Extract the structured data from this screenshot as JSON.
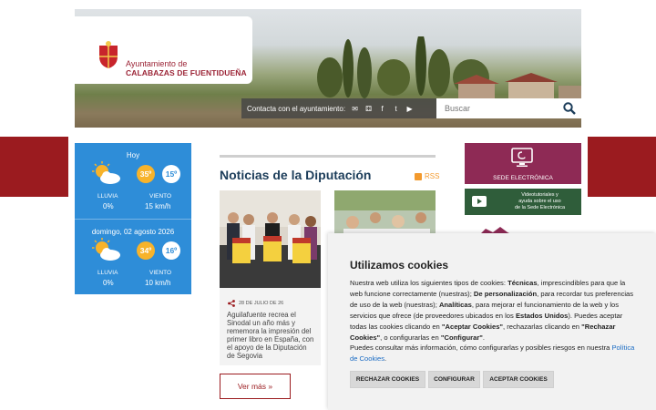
{
  "header": {
    "logo_line1": "Ayuntamiento de",
    "logo_line2": "CALABAZAS DE FUENTIDUEÑA",
    "contact_label": "Contacta con el ayuntamiento:",
    "contact_icons": [
      "mail-icon",
      "sitemap-icon",
      "facebook-icon",
      "twitter-icon",
      "youtube-icon"
    ],
    "search_placeholder": "Buscar"
  },
  "weather": {
    "days": [
      {
        "date": "Hoy",
        "tmax": "35º",
        "tmin": "15º",
        "rain_label": "LLUVIA",
        "rain": "0%",
        "wind_label": "VIENTO",
        "wind": "15 km/h"
      },
      {
        "date": "domingo, 02 agosto 2026",
        "tmax": "34º",
        "tmin": "16º",
        "rain_label": "LLUVIA",
        "rain": "0%",
        "wind_label": "VIENTO",
        "wind": "10 km/h"
      }
    ]
  },
  "news": {
    "title": "Noticias de la Diputación",
    "rss": "RSS",
    "cards": [
      {
        "date": "28 DE JULIO DE 26",
        "text": "Aguilafuente recrea el Sinodal un año más y rememora la impresión del primer libro en España, con el apoyo de la Diputación de Segovia"
      }
    ],
    "more": "Ver más  »"
  },
  "sidebar": {
    "sede": "SEDE ELECTRÓNICA",
    "video_lines": [
      "Videotutoriales y",
      "ayuda sobre el uso",
      "de la Sede Electrónica"
    ]
  },
  "cookies": {
    "title": "Utilizamos cookies",
    "btn_reject": "RECHAZAR COOKIES",
    "btn_config": "CONFIGURAR",
    "btn_accept": "ACEPTAR COOKIES",
    "policy_link": "Política de Cookies"
  },
  "colors": {
    "brand_red": "#9b1b1f",
    "weather_blue": "#2e8dd8",
    "sede_purple": "#8e2a55",
    "video_green": "#2f5d3a",
    "title_navy": "#1c3d5a"
  }
}
